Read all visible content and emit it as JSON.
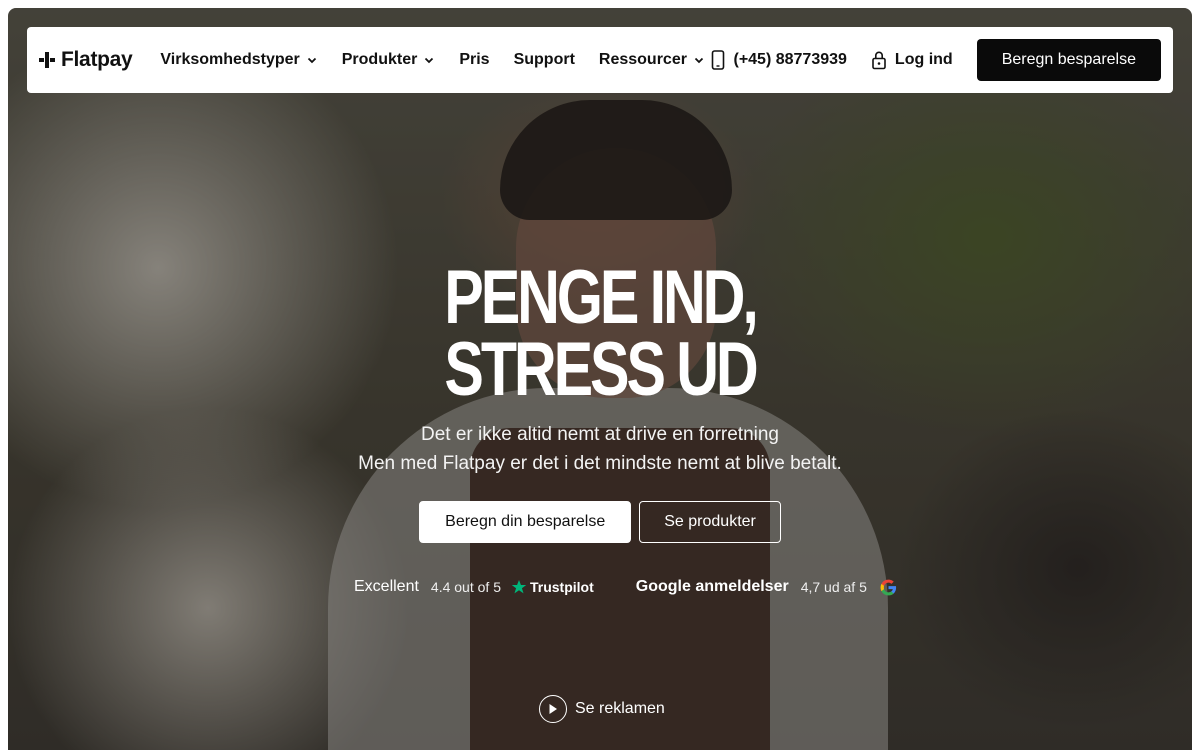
{
  "brand": {
    "name": "Flatpay"
  },
  "nav": {
    "items": [
      {
        "label": "Virksomhedstyper",
        "has_dropdown": true
      },
      {
        "label": "Produkter",
        "has_dropdown": true
      },
      {
        "label": "Pris",
        "has_dropdown": false
      },
      {
        "label": "Support",
        "has_dropdown": false
      },
      {
        "label": "Ressourcer",
        "has_dropdown": true
      }
    ],
    "phone": "(+45) 88773939",
    "login": "Log ind",
    "cta": "Beregn besparelse"
  },
  "hero": {
    "headline_line1": "PENGE IND,",
    "headline_line2": "STRESS UD",
    "subtitle_line1": "Det er ikke altid nemt at drive en forretning",
    "subtitle_line2": "Men med Flatpay er det i det mindste nemt at blive betalt.",
    "primary_button": "Beregn din besparelse",
    "secondary_button": "Se produkter"
  },
  "ratings": {
    "trustpilot": {
      "label": "Excellent",
      "score": "4.4 out of 5",
      "brand": "Trustpilot"
    },
    "google": {
      "label": "Google anmeldelser",
      "score": "4,7 ud af 5"
    }
  },
  "video": {
    "label": "Se reklamen"
  },
  "colors": {
    "trustpilot_green": "#00b67a",
    "cta_dark": "#0a0a0a"
  },
  "icons": {
    "logo": "flatpay-logo-icon",
    "dropdown": "chevron-down-icon",
    "phone": "phone-icon",
    "login": "lock-icon",
    "trustpilot": "star-icon",
    "google": "google-g-icon",
    "play": "play-icon"
  }
}
